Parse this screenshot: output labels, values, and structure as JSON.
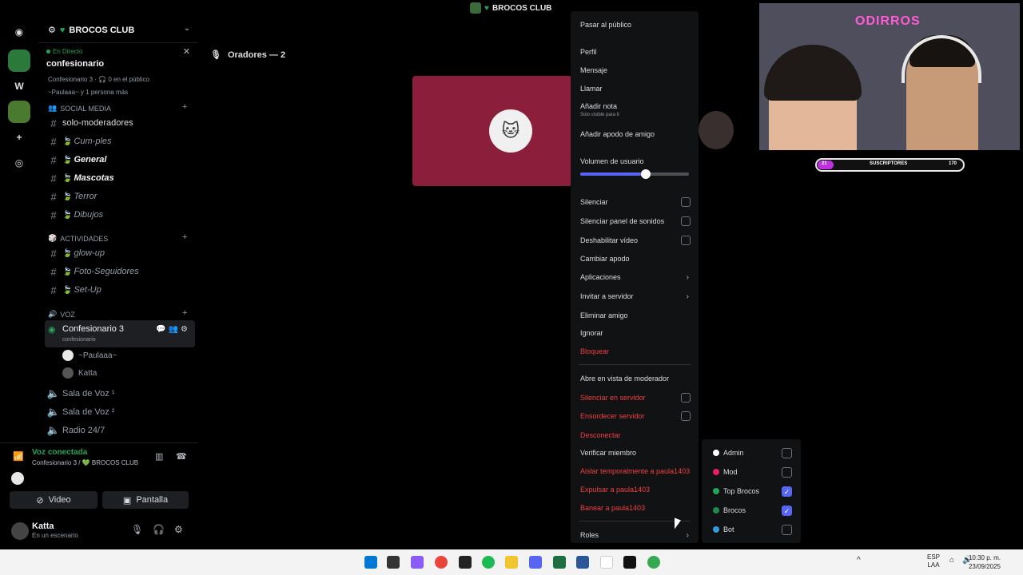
{
  "window": {
    "title": "BROCOS CLUB"
  },
  "server": {
    "name": "BROCOS CLUB"
  },
  "live": {
    "status": "En Directo",
    "topic": "confesionario",
    "meta": "Confesionario 3 · 🎧 0 en el público",
    "meta2": "~Paulaaa~ y 1 persona más"
  },
  "categories": {
    "social": "SOCIAL MEDIA",
    "actividades": "ACTIVIDADES",
    "voz": "VOZ"
  },
  "channels": {
    "social": [
      "solo-moderadores",
      "Cum-ples",
      "General",
      "Mascotas",
      "Terror",
      "Dibujos"
    ],
    "actividades": [
      "glow-up",
      "Foto-Seguidores",
      "Set-Up"
    ],
    "voice": [
      "Sala de Voz ¹",
      "Sala de Voz ²",
      "Radio 24/7"
    ]
  },
  "active_voice": {
    "name": "Confesionario 3",
    "sub": "confesionario"
  },
  "members": [
    "~Paulaaa~",
    "Katta"
  ],
  "voice_panel": {
    "status": "Voz conectada",
    "sub": "Confesionario 3 / 💚 BROCOS CLUB",
    "video_label": "Video",
    "screen_label": "Pantalla"
  },
  "user": {
    "name": "Katta",
    "status": "En un escenario"
  },
  "main": {
    "speakers": "Oradores — 2"
  },
  "menu": {
    "items": [
      "Pasar al público",
      "Perfil",
      "Mensaje",
      "Llamar",
      "Añadir nota",
      "Solo visible para ti",
      "Añadir apodo de amigo",
      "Volumen de usuario",
      "Silenciar",
      "Silenciar panel de sonidos",
      "Deshabilitar vídeo",
      "Cambiar apodo",
      "Aplicaciones",
      "Invitar a servidor",
      "Eliminar amigo",
      "Ignorar",
      "Bloquear",
      "Abre en vista de moderador",
      "Silenciar en servidor",
      "Ensordecer servidor",
      "Desconectar",
      "Verificar miembro",
      "Aislar temporalmente a paula1403",
      "Expulsar a paula1403",
      "Banear a paula1403",
      "Roles"
    ],
    "volume": 0.6
  },
  "roles": [
    {
      "name": "Admin",
      "color": "#ffffff",
      "checked": false
    },
    {
      "name": "Mod",
      "color": "#e91e63",
      "checked": false
    },
    {
      "name": "Top Brocos",
      "color": "#23a55a",
      "checked": true
    },
    {
      "name": "Brocos",
      "color": "#1f8b4c",
      "checked": true
    },
    {
      "name": "Bot",
      "color": "#3498db",
      "checked": false
    }
  ],
  "stream_overlay": {
    "neon": "ODIRROS",
    "sub_count_left": "21",
    "sub_label": "SUSCRIPTORES",
    "sub_count_right": "170"
  },
  "taskbar": {
    "lang": "ESP",
    "lang2": "LAA",
    "time": "10:30 p. m.",
    "date": "23/09/2025"
  },
  "colors": {
    "accent": "#5865f2",
    "online": "#23a55a",
    "danger": "#f23f43",
    "tile": "#8b1e3a"
  }
}
